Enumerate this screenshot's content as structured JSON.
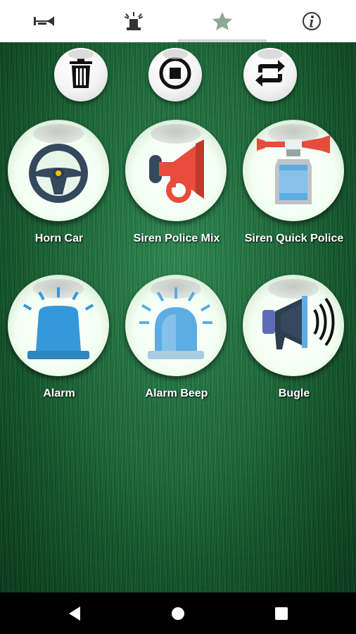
{
  "tabs": [
    {
      "name": "horn-icon"
    },
    {
      "name": "siren-icon"
    },
    {
      "name": "star-icon",
      "selected": true
    },
    {
      "name": "info-icon"
    }
  ],
  "actions": [
    {
      "name": "delete-button",
      "icon": "trash-icon"
    },
    {
      "name": "stop-button",
      "icon": "stop-icon"
    },
    {
      "name": "repeat-button",
      "icon": "repeat-icon"
    }
  ],
  "sounds": [
    {
      "label": "Horn Car",
      "icon": "steering-wheel-icon"
    },
    {
      "label": "Siren Police Mix",
      "icon": "red-horn-icon"
    },
    {
      "label": "Siren Quick Police",
      "icon": "air-horn-icon"
    },
    {
      "label": "Alarm",
      "icon": "alarm-light-icon"
    },
    {
      "label": "Alarm Beep",
      "icon": "beacon-light-icon"
    },
    {
      "label": "Bugle",
      "icon": "megaphone-icon"
    }
  ],
  "colors": {
    "accent_tab": "#8fa896",
    "background_green": "#1d6a3a",
    "tab_bar": "#ffffff",
    "nav_bar": "#000000"
  },
  "nav": [
    {
      "name": "back-nav-icon"
    },
    {
      "name": "home-nav-icon"
    },
    {
      "name": "recents-nav-icon"
    }
  ]
}
